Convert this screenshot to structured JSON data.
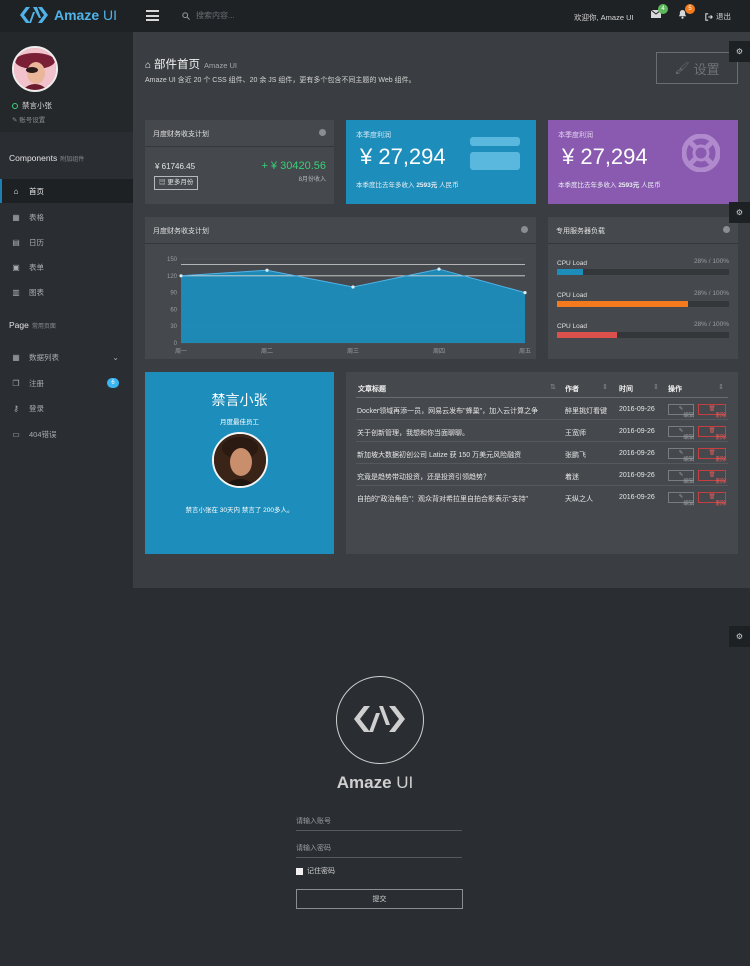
{
  "topbar": {
    "brand": "Amaze",
    "brand_ui": "UI",
    "search_placeholder": "搜索内容...",
    "welcome": "欢迎你, Amaze UI",
    "mail_badge": "4",
    "bell_badge": "5",
    "logout": "退出",
    "colors": {
      "accent": "#4fb3e8",
      "mail_badge": "#5eb95e",
      "bell_badge": "#f37b1d"
    }
  },
  "sidebar": {
    "user_name": "禁言小张",
    "user_setting": "账号设置",
    "sections": [
      {
        "title": "Components",
        "subtitle": "附加组件"
      },
      {
        "title": "Page",
        "subtitle": "常用页面"
      }
    ],
    "items": [
      {
        "label": "首页",
        "icon": "home-icon",
        "active": true
      },
      {
        "label": "表格",
        "icon": "table-icon"
      },
      {
        "label": "日历",
        "icon": "calendar-icon"
      },
      {
        "label": "表单",
        "icon": "form-icon"
      },
      {
        "label": "图表",
        "icon": "chart-icon"
      },
      {
        "label": "数据列表",
        "icon": "table-icon"
      },
      {
        "label": "注册",
        "icon": "copy-icon",
        "badge": "6"
      },
      {
        "label": "登录",
        "icon": "key-icon"
      },
      {
        "label": "404错误",
        "icon": "monitor-icon"
      }
    ]
  },
  "header": {
    "title": "部件首页",
    "subtitle": "Amaze UI",
    "desc": "Amaze UI 含近 20 个 CSS 组件、20 余 JS 组件，更有多个包含不同主题的 Web 组件。",
    "setting_button": "设置"
  },
  "finance_card": {
    "title": "月度财务收支计划",
    "amount": "¥ 61746.45",
    "income": "+ ¥ 30420.56",
    "income_caption": "8月份收入",
    "more_button": "更多月份"
  },
  "profit_blue": {
    "title": "本季度利润",
    "amount": "¥ 27,294",
    "compare_prefix": "本季度比去年多收入",
    "compare_value": "2593元",
    "compare_suffix": "人民币"
  },
  "profit_purple": {
    "title": "本季度利润",
    "amount": "¥ 27,294",
    "compare_prefix": "本季度比去年多收入",
    "compare_value": "2593元",
    "compare_suffix": "人民币"
  },
  "chart_card": {
    "title": "月度财务收支计划"
  },
  "chart_data": {
    "type": "area",
    "categories": [
      "周一",
      "周二",
      "周三",
      "周四",
      "周五"
    ],
    "values": [
      120,
      130,
      100,
      132,
      90
    ],
    "ylim": [
      0,
      150
    ],
    "yticks": [
      "150",
      "120",
      "90",
      "60",
      "30",
      "0"
    ],
    "reference_lines": [
      140,
      120
    ],
    "color": "#1d8dbb"
  },
  "server_card": {
    "title": "专用服务器负载",
    "rows": [
      {
        "label": "CPU Load",
        "value": "28% / 100%",
        "fill": 0.15,
        "color": "#1d8dbb"
      },
      {
        "label": "CPU Load",
        "value": "28% / 100%",
        "fill": 0.76,
        "color": "#f37b1d"
      },
      {
        "label": "CPU Load",
        "value": "28% / 100%",
        "fill": 0.35,
        "color": "#dd514c"
      }
    ]
  },
  "profile_card": {
    "name": "禁言小张",
    "role": "月度最佳员工",
    "note": "禁言小张在 30天内 禁言了 200多人。"
  },
  "article_table": {
    "headers": [
      "文章标题",
      "作者",
      "时间",
      "操作"
    ],
    "edit_label": "编辑",
    "delete_label": "删除",
    "rows": [
      {
        "title": "Docker领域再添一员，网易云发布\"蜂巢\"，加入云计算之争",
        "author": "醉里挑灯看键",
        "date": "2016-09-26"
      },
      {
        "title": "关于创新管理，我想和你当面聊聊。",
        "author": "王宽师",
        "date": "2016-09-26"
      },
      {
        "title": "新加坡大数据初创公司 Latize 获 150 万美元风险融资",
        "author": "张鹏飞",
        "date": "2016-09-26"
      },
      {
        "title": "究竟是趋势带动投资，还是投资引领趋势？",
        "author": "着迷",
        "date": "2016-09-26"
      },
      {
        "title": "自拍的\"政治角色\"：观众背对希拉里自拍合影表示\"支持\"",
        "author": "天纵之人",
        "date": "2016-09-26"
      }
    ]
  },
  "login": {
    "brand": "Amaze",
    "brand_ui": "UI",
    "account_placeholder": "请输入账号",
    "password_placeholder": "请输入密码",
    "remember": "记住密码",
    "submit": "提交"
  }
}
